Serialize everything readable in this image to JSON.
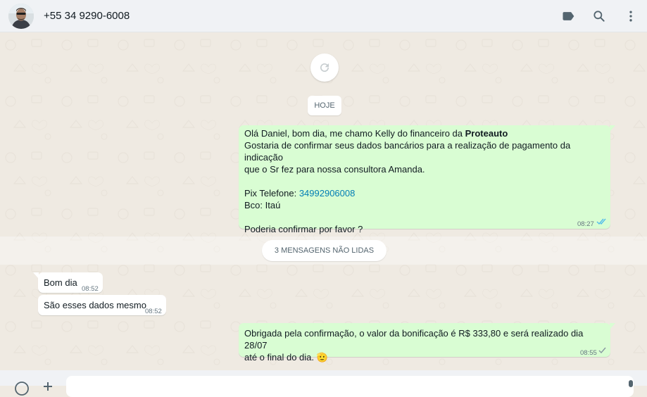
{
  "header": {
    "contact_name": "+55 34 9290-6008",
    "icons": [
      "label-icon",
      "search-icon",
      "menu-dots-icon"
    ]
  },
  "chat": {
    "date_chip": "HOJE",
    "unread_label": "3 MENSAGENS NÃO LIDAS",
    "messages": [
      {
        "direction": "out",
        "line1_prefix": "Olá Daniel, bom dia, me chamo Kelly do financeiro da ",
        "line1_bold": "Proteauto",
        "line2": "Gostaria de confirmar seus dados bancários para a realização de pagamento da indicação",
        "line3": "que o Sr fez para nossa consultora Amanda.",
        "pix_label": "Pix Telefone: ",
        "pix_link": "34992906008",
        "bank": "Bco: Itaú",
        "closing": "Poderia confirmar por favor ?",
        "time": "08:27",
        "status": "read"
      },
      {
        "direction": "in",
        "text": "Bom dia",
        "time": "08:52"
      },
      {
        "direction": "in",
        "text": "São esses dados mesmo",
        "time": "08:52"
      },
      {
        "direction": "out",
        "line1": "Obrigada pela confirmação, o valor da bonificação é R$ 333,80 e será realizado dia 28/07",
        "line2": "até o final do dia. 🫡",
        "time": "08:55",
        "status": "delivered"
      }
    ]
  },
  "colors": {
    "outgoing_bubble": "#d9fdd3",
    "incoming_bubble": "#ffffff",
    "chat_background": "#efeae2",
    "link": "#027eb5",
    "read_ticks": "#53bdeb"
  }
}
